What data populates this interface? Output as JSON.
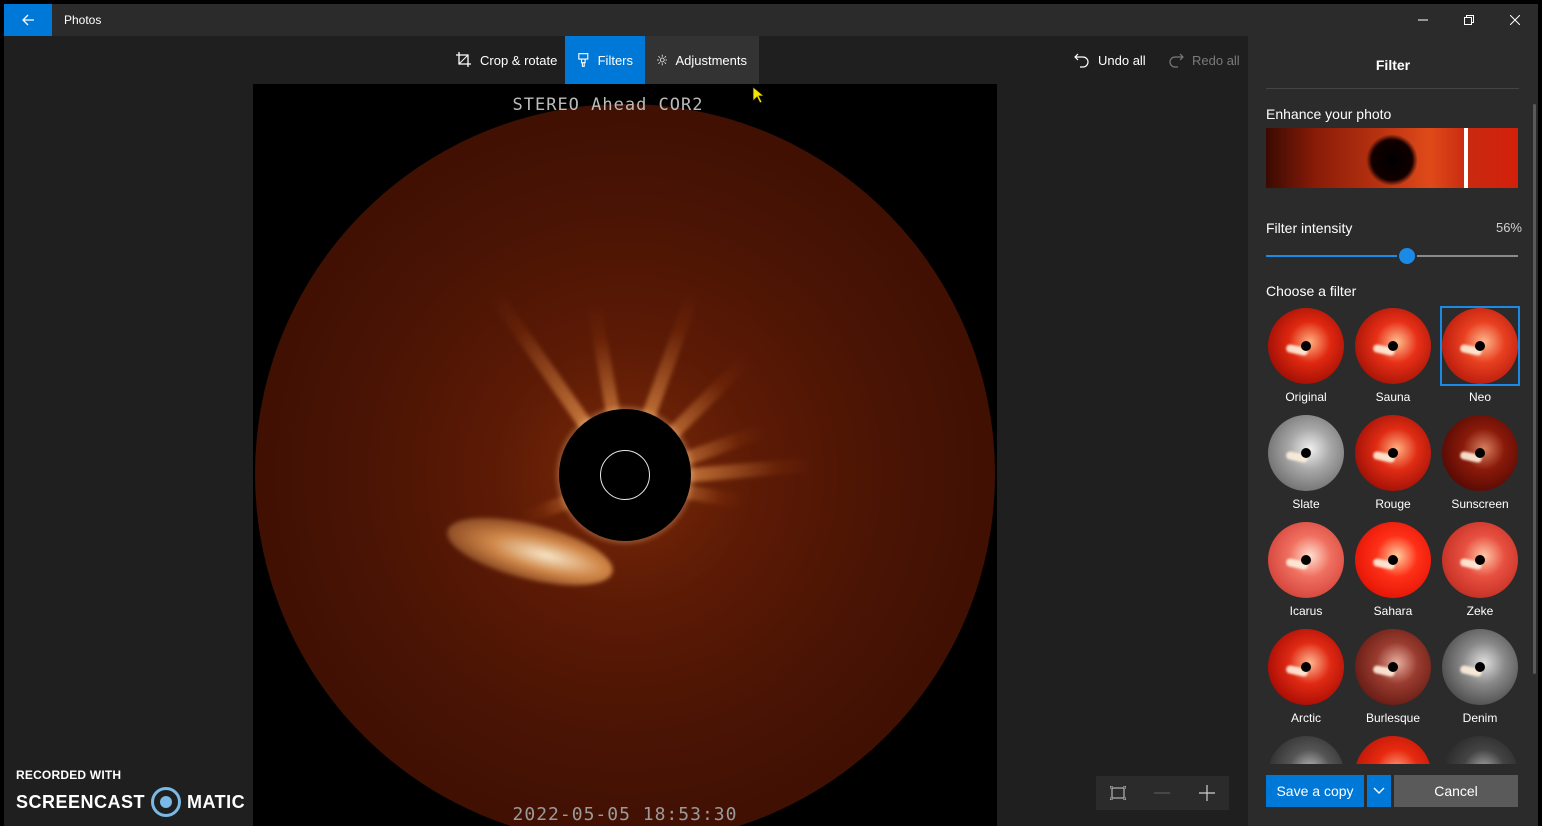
{
  "app": {
    "title": "Photos"
  },
  "toolbar": {
    "crop_label": "Crop & rotate",
    "filters_label": "Filters",
    "adjustments_label": "Adjustments",
    "undo_label": "Undo all",
    "redo_label": "Redo all"
  },
  "image": {
    "caption": "STEREO Ahead COR2",
    "timestamp": "2022-05-05  18:53:30"
  },
  "panel": {
    "title": "Filter",
    "enhance_label": "Enhance your photo",
    "intensity_label": "Filter intensity",
    "intensity_value": "56%",
    "intensity_fraction": 0.56,
    "choose_label": "Choose a filter",
    "filters": [
      {
        "name": "Original",
        "selected": false,
        "bg": "radial-gradient(circle at 55% 45%, #ffb080 0%, #e02810 35%, #a81206 70%, #500500 100%)"
      },
      {
        "name": "Sauna",
        "selected": false,
        "bg": "radial-gradient(circle at 55% 45%, #ffc090 0%, #e83018 35%, #b01808 70%, #5a0600 100%)"
      },
      {
        "name": "Neo",
        "selected": true,
        "bg": "radial-gradient(circle at 55% 45%, #ffb890 0%, #e84020 35%, #c02010 70%, #600800 100%)"
      },
      {
        "name": "Slate",
        "selected": false,
        "bg": "radial-gradient(circle at 55% 45%, #f0f0f0 0%, #a8a8a8 35%, #787878 70%, #3a3a3a 100%)"
      },
      {
        "name": "Rouge",
        "selected": false,
        "bg": "radial-gradient(circle at 55% 45%, #ffb080 0%, #e02c14 35%, #a81408 70%, #4a0400 100%)"
      },
      {
        "name": "Sunscreen",
        "selected": false,
        "bg": "radial-gradient(circle at 55% 45%, #d88060 0%, #8a1a0a 35%, #5e0c04 70%, #2a0200 100%)"
      },
      {
        "name": "Icarus",
        "selected": false,
        "bg": "radial-gradient(circle at 55% 45%, #ffe0d0 0%, #f07060 35%, #d84a40 70%, #a02a20 100%)"
      },
      {
        "name": "Sahara",
        "selected": false,
        "bg": "radial-gradient(circle at 55% 45%, #ffd0a0 0%, #ff3018 35%, #e81808 70%, #a00800 100%)"
      },
      {
        "name": "Zeke",
        "selected": false,
        "bg": "radial-gradient(circle at 55% 45%, #ffc8a8 0%, #e85040 35%, #c83428 70%, #7a1008 100%)"
      },
      {
        "name": "Arctic",
        "selected": false,
        "bg": "radial-gradient(circle at 55% 45%, #ffb890 0%, #e02a14 35%, #b01006 70%, #580400 100%)"
      },
      {
        "name": "Burlesque",
        "selected": false,
        "bg": "radial-gradient(circle at 55% 45%, #e8b0a0 0%, #9a3c30 35%, #6e2018 70%, #380a06 100%)"
      },
      {
        "name": "Denim",
        "selected": false,
        "bg": "radial-gradient(circle at 55% 45%, #e0e0e0 0%, #8a8a8a 35%, #555 70%, #222 100%)"
      },
      {
        "name": "",
        "selected": false,
        "bg": "radial-gradient(circle at 55% 45%, #bbb 0%, #555 35%, #333 70%, #111 100%)"
      },
      {
        "name": "",
        "selected": false,
        "bg": "radial-gradient(circle at 55% 45%, #ffa080 0%, #e82a10 35%, #c01808 70%, #700600 100%)"
      },
      {
        "name": "",
        "selected": false,
        "bg": "radial-gradient(circle at 55% 45%, #aaa 0%, #444 35%, #2a2a2a 70%, #111 100%)"
      }
    ],
    "save_label": "Save a copy",
    "cancel_label": "Cancel"
  },
  "watermark": {
    "line1": "RECORDED WITH",
    "brand_left": "SCREENCAST",
    "brand_right": "MATIC"
  },
  "colors": {
    "accent": "#0078d7",
    "panel": "#2b2b2b",
    "background": "#1f1f1f"
  }
}
